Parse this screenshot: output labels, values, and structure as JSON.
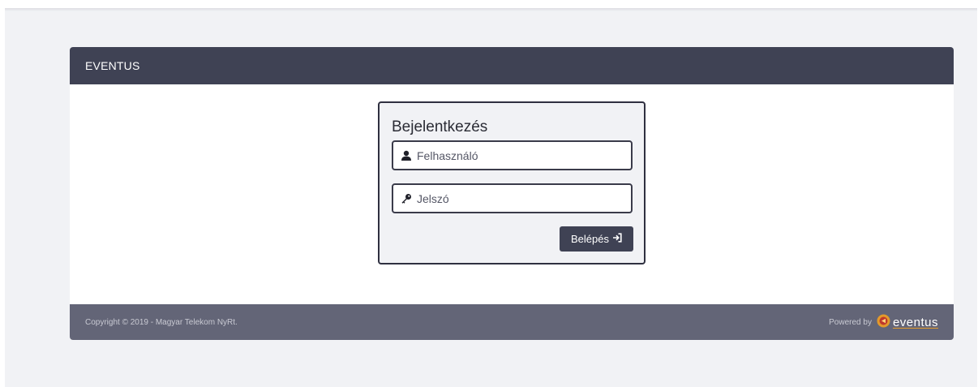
{
  "header": {
    "title": "EVENTUS"
  },
  "login": {
    "title": "Bejelentkezés",
    "username_placeholder": "Felhasználó",
    "password_placeholder": "Jelszó",
    "submit_label": "Belépés"
  },
  "footer": {
    "copyright": "Copyright © 2019 - Magyar Telekom NyRt.",
    "powered_by": "Powered by",
    "logo_text": "eventus"
  },
  "colors": {
    "header_bg": "#3f4254",
    "footer_bg": "#636577",
    "page_bg": "#f1f2f5",
    "logo_accent": "#e39a2b"
  }
}
